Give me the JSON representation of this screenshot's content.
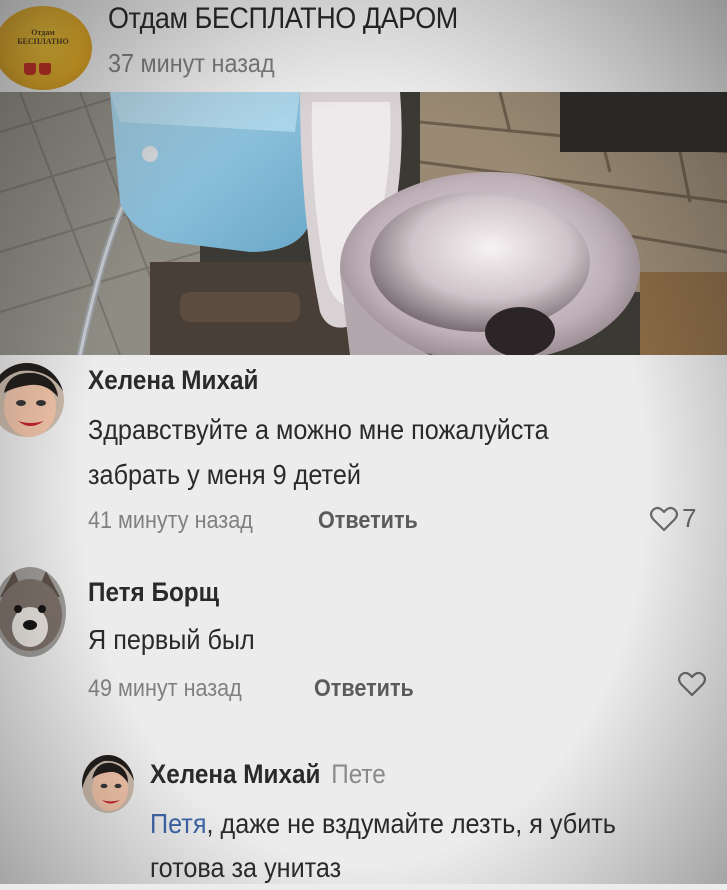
{
  "post": {
    "group_name": "Отдам БЕСПЛАТНО ДАРОМ",
    "time": "37 минут назад",
    "avatar": {
      "line1": "Отдам",
      "line2": "БЕСПЛАТНО"
    }
  },
  "comments": [
    {
      "author": "Хелена Михай",
      "text_line1": "Здравствуйте а можно мне пожалуйста",
      "text_line2": "забрать у меня 9 детей",
      "time": "41 минуту назад",
      "reply_label": "Ответить",
      "likes": "7"
    },
    {
      "author": "Петя Борщ",
      "text_line1": "Я первый был",
      "time": "49 минут назад",
      "reply_label": "Ответить"
    }
  ],
  "reply": {
    "author": "Хелена Михай",
    "reply_to": "Пете",
    "mention": "Петя",
    "text_rest": ", даже не вздумайте лезть, я убить",
    "text_line2": "готова за унитаз"
  },
  "colors": {
    "mention": "#3b64a8",
    "background": "#ececec"
  }
}
